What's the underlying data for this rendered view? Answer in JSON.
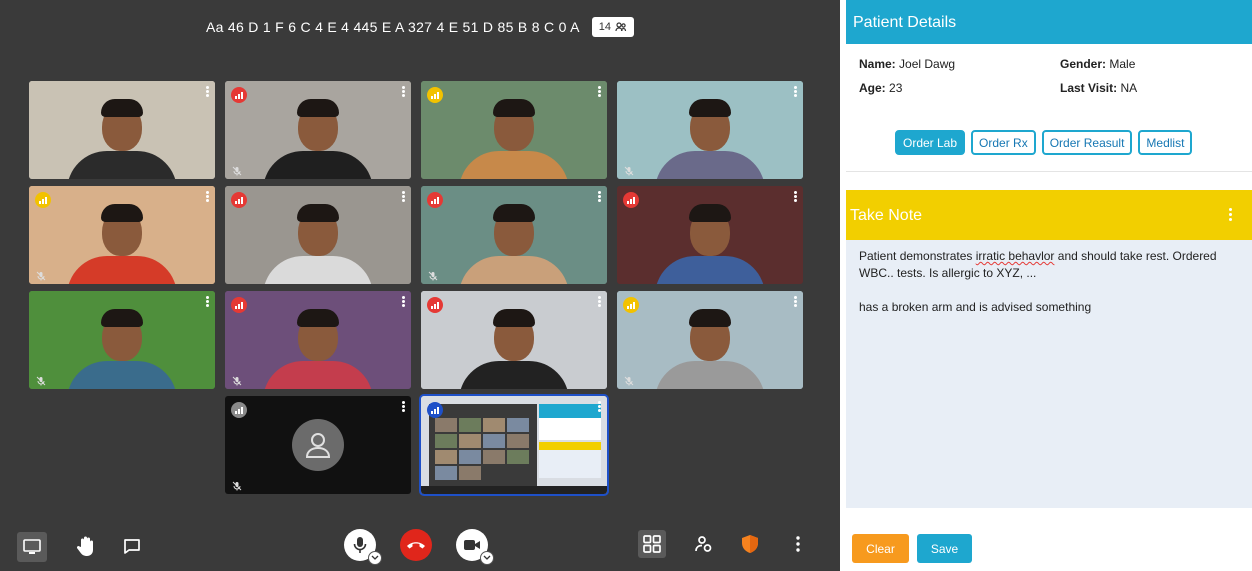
{
  "room": {
    "name": "Aa 46 D 1 F 6 C 4 E 4 445 E A 327 4 E 51 D 85 B 8 C 0 A",
    "participant_count": "14",
    "participants_icon": "participants-icon"
  },
  "tiles": [
    {
      "id": "1",
      "quality": "none",
      "muted": false,
      "bg": "#c9c2b4",
      "body": "#2b2b2b"
    },
    {
      "id": "2",
      "quality": "red",
      "muted": true,
      "bg": "#a9a59f",
      "body": "#1f1f1f"
    },
    {
      "id": "3",
      "quality": "yellow",
      "muted": false,
      "bg": "#6c8b6c",
      "body": "#c7894a"
    },
    {
      "id": "4",
      "quality": "none",
      "muted": true,
      "bg": "#9cc0c4",
      "body": "#6a6a8a"
    },
    {
      "id": "5",
      "quality": "yellow",
      "muted": true,
      "bg": "#d8b08a",
      "body": "#d53b28"
    },
    {
      "id": "6",
      "quality": "red",
      "muted": false,
      "bg": "#9a9690",
      "body": "#dadada"
    },
    {
      "id": "7",
      "quality": "red",
      "muted": true,
      "bg": "#6b8e85",
      "body": "#c9a07a"
    },
    {
      "id": "8",
      "quality": "red",
      "muted": false,
      "bg": "#5b2e2e",
      "body": "#3e5f9b"
    },
    {
      "id": "9",
      "quality": "none",
      "muted": true,
      "bg": "#4f8f3c",
      "body": "#3a6c8c"
    },
    {
      "id": "10",
      "quality": "red",
      "muted": true,
      "bg": "#6d4f7a",
      "body": "#c43d4d"
    },
    {
      "id": "11",
      "quality": "red",
      "muted": false,
      "bg": "#c9ccd0",
      "body": "#222222"
    },
    {
      "id": "12",
      "quality": "yellow",
      "muted": true,
      "bg": "#a8bcc4",
      "body": "#9a9a9a"
    },
    {
      "id": "13",
      "quality": "gray",
      "muted": true,
      "bg": "#111111",
      "avatar": true
    },
    {
      "id": "14",
      "quality": "blue",
      "muted": false,
      "bg": "#e8e8e8",
      "screenshare": true,
      "active": true
    }
  ],
  "toolbar": {
    "left": [
      "screen-share-icon",
      "raise-hand-icon",
      "chat-icon"
    ],
    "center": [
      "microphone-icon",
      "end-call-icon",
      "camera-icon"
    ],
    "right": [
      "tile-view-icon",
      "participants-icon",
      "security-shield-icon",
      "more-options-icon"
    ]
  },
  "patient": {
    "header": "Patient Details",
    "name_label": "Name:",
    "name": "Joel Dawg",
    "gender_label": "Gender:",
    "gender": "Male",
    "age_label": "Age:",
    "age": "23",
    "last_visit_label": "Last Visit:",
    "last_visit": "NA",
    "buttons": [
      "Order Lab",
      "Order Rx",
      "Order Reasult",
      "Medlist"
    ]
  },
  "note": {
    "header": "Take Note",
    "line1_a": "Patient demonstrates ",
    "line1_b": "irratic behavlor",
    "line1_c": " and should take rest. Ordered WBC.. tests. Is allergic to XYZ, ...",
    "line2": "has a broken arm and is advised something",
    "clear_label": "Clear",
    "save_label": "Save"
  },
  "colors": {
    "call_bg": "#3a3a3a",
    "patient_header": "#1ea7cf",
    "note_header": "#f2cf00",
    "note_body": "#e8eef6",
    "clear": "#f79a1e",
    "save": "#1ea7cf",
    "end_call": "#e0261b"
  }
}
